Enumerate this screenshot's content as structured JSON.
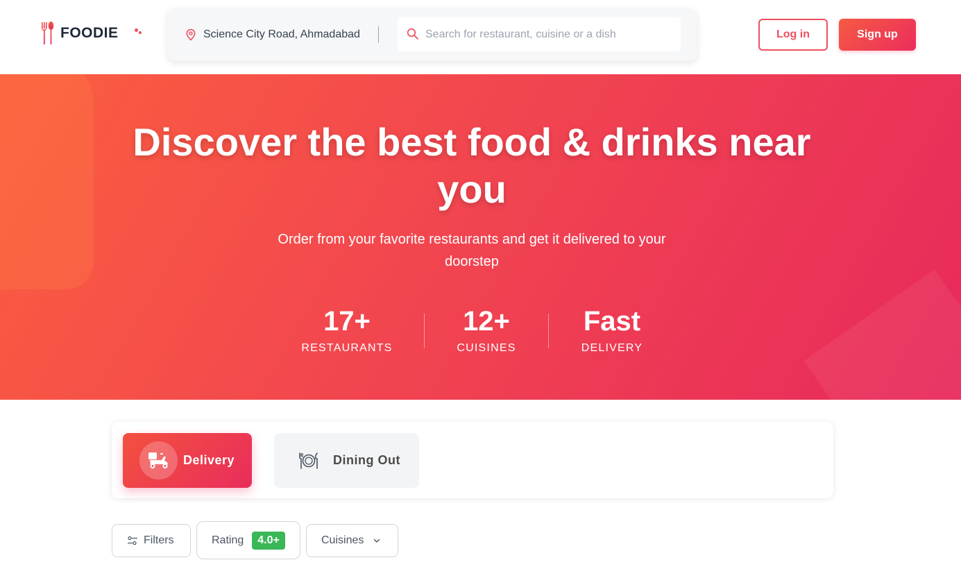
{
  "app": {
    "name": "FOODIE"
  },
  "header": {
    "location": "Science City Road, Ahmadabad",
    "search_placeholder": "Search for restaurant, cuisine or a dish",
    "login_label": "Log in",
    "signup_label": "Sign up"
  },
  "hero": {
    "title": "Discover the best food & drinks near you",
    "subtitle": "Order from your favorite restaurants and get it delivered to your doorstep",
    "stats": [
      {
        "value": "17+",
        "label": "RESTAURANTS"
      },
      {
        "value": "12+",
        "label": "CUISINES"
      },
      {
        "value": "Fast",
        "label": "DELIVERY"
      }
    ]
  },
  "modes": [
    {
      "label": "Delivery",
      "icon": "scooter-icon",
      "active": true
    },
    {
      "label": "Dining Out",
      "icon": "dining-icon",
      "active": false
    }
  ],
  "filters": {
    "filters_label": "Filters",
    "rating_label": "Rating",
    "rating_value": "4.0+",
    "cuisines_label": "Cuisines"
  },
  "colors": {
    "brand": "#ef4f5f",
    "hero_start": "#fb5f3f",
    "hero_end": "#e8295c",
    "rating_badge": "#3ab757"
  }
}
